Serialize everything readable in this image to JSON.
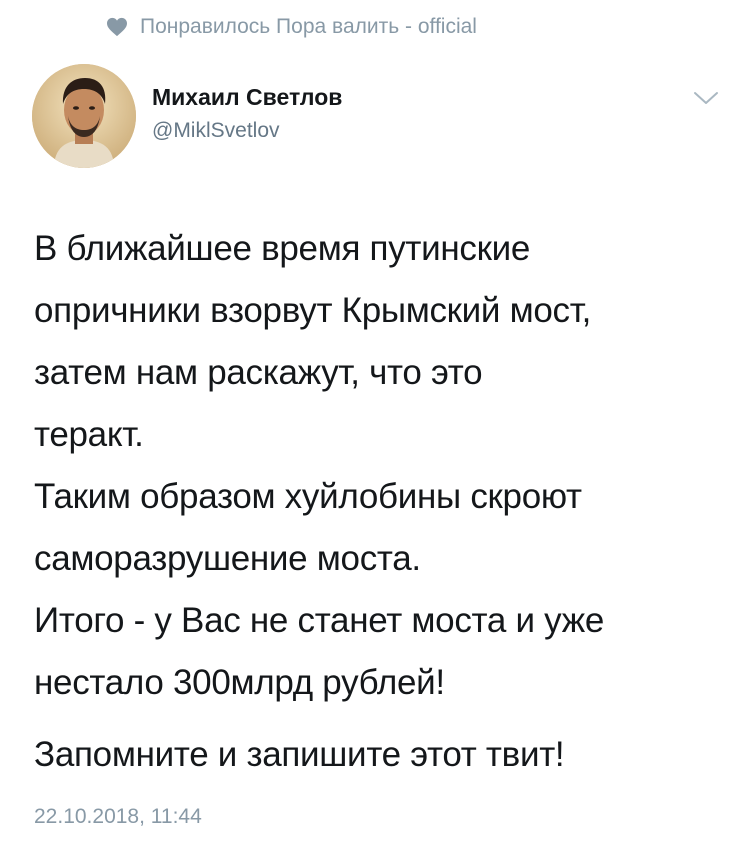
{
  "social_context": {
    "text": "Понравилось Пора валить - official",
    "icon": "heart-icon",
    "color": "#8899a6"
  },
  "author": {
    "name": "Михаил Светлов",
    "handle": "@MiklSvetlov",
    "avatar": "profile-photo"
  },
  "menu": {
    "icon": "chevron-down-icon"
  },
  "tweet": {
    "lines": [
      "В ближайшее время путинские",
      "опричники взорвут Крымский мост,",
      "затем нам раскажут, что это",
      "теракт.",
      "Таким образом хуйлобины скроют",
      "саморазрушение моста.",
      "Итого - у Вас не станет моста и уже",
      "нестало 300млрд рублей!",
      "Запомните и запишите этот твит!"
    ],
    "timestamp": "22.10.2018, 11:44"
  }
}
